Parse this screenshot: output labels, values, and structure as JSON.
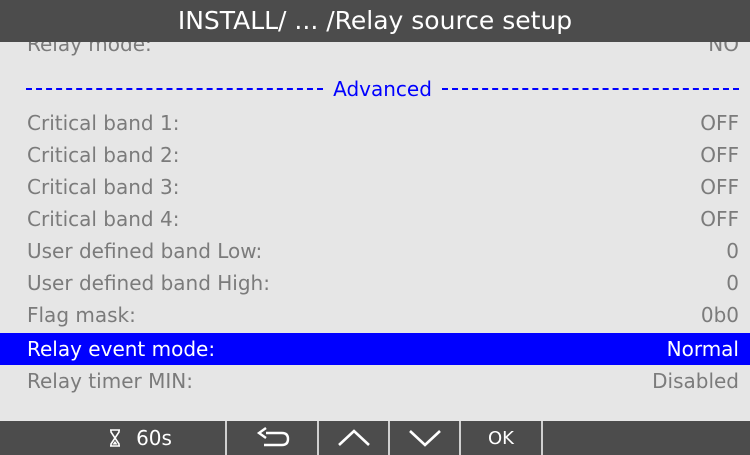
{
  "title": "INSTALL/ ... /Relay source setup",
  "partial_row": {
    "label": "Relay mode:",
    "value": "NO"
  },
  "separator_label": "Advanced",
  "rows": [
    {
      "label": "Critical band 1:",
      "value": "OFF"
    },
    {
      "label": "Critical band 2:",
      "value": "OFF"
    },
    {
      "label": "Critical band 3:",
      "value": "OFF"
    },
    {
      "label": "Critical band 4:",
      "value": "OFF"
    },
    {
      "label": "User defined band Low:",
      "value": "0"
    },
    {
      "label": "User defined band High:",
      "value": "0"
    },
    {
      "label": "Flag mask:",
      "value": "0b0"
    },
    {
      "label": "Relay event mode:",
      "value": "Normal"
    },
    {
      "label": "Relay timer MIN:",
      "value": "Disabled"
    }
  ],
  "selected_index": 7,
  "bottom_bar": {
    "timer_icon": "hourglass-icon",
    "timer_label": "60s",
    "back_icon": "back-arrow-icon",
    "up_icon": "chevron-up-icon",
    "down_icon": "chevron-down-icon",
    "ok_label": "OK"
  },
  "colors": {
    "title_bar": "#4c4c4c",
    "background": "#e6e6e6",
    "text": "#7b7b7b",
    "accent": "#0000ff",
    "selected_text": "#ffffff"
  }
}
